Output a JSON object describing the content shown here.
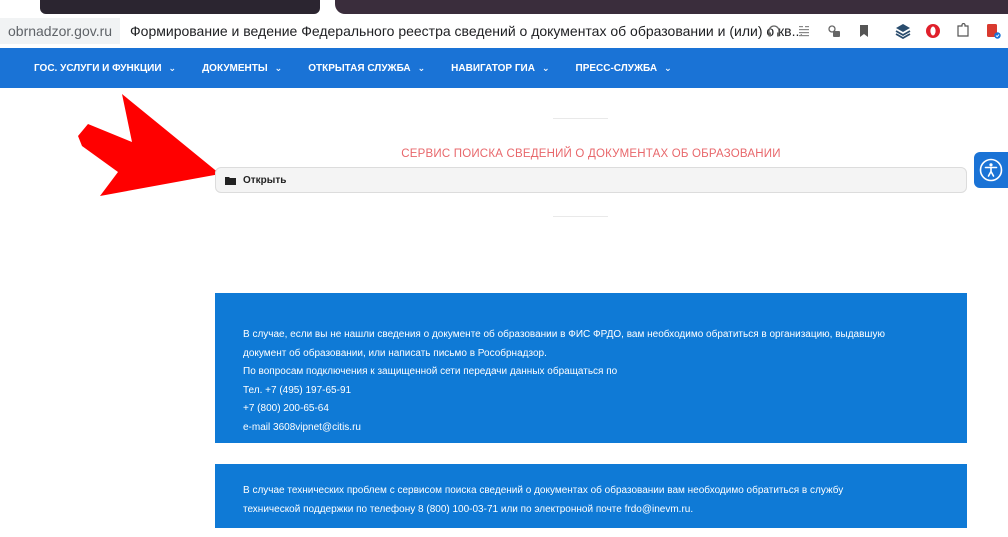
{
  "browser": {
    "url": "obrnadzor.gov.ru",
    "page_title": "Формирование и ведение Федерального реестра сведений о документах об образовании и (или) о кв...",
    "toolbar_icons": [
      "headphones-icon",
      "reader-icon",
      "extension-icon",
      "bookmark-icon",
      "layers-icon",
      "opera-icon",
      "puzzle-icon",
      "pdf-icon"
    ]
  },
  "nav": {
    "items": [
      {
        "label": "ГОС. УСЛУГИ И ФУНКЦИИ"
      },
      {
        "label": "ДОКУМЕНТЫ"
      },
      {
        "label": "ОТКРЫТАЯ СЛУЖБА"
      },
      {
        "label": "НАВИГАТОР ГИА"
      },
      {
        "label": "ПРЕСС-СЛУЖБА"
      }
    ]
  },
  "service": {
    "title": "СЕРВИС ПОИСКА СВЕДЕНИЙ О ДОКУМЕНТАХ ОБ ОБРАЗОВАНИИ",
    "open_label": "Открыть"
  },
  "info1": {
    "lines": [
      "В случае, если вы не нашли сведения о документе об образовании в ФИС ФРДО, вам необходимо обратиться в организацию, выдавшую",
      "документ об образовании, или написать письмо в Рособрнадзор.",
      "По вопросам подключения к защищенной сети передачи данных обращаться по",
      "Тел. +7 (495) 197-65-91",
      "+7 (800) 200-65-64",
      "e-mail 3608vipnet@citis.ru"
    ]
  },
  "info2": {
    "lines": [
      "В случае технических проблем с сервисом поиска сведений о документах об образовании вам необходимо обратиться в службу",
      "технической поддержки по телефону  8 (800) 100-03-71 или по электронной почте frdo@inevm.ru."
    ]
  },
  "colors": {
    "nav_bg": "#1a73d6",
    "info_bg": "#0f7ad6",
    "service_title": "#e8676b",
    "arrow": "#ff0000"
  }
}
